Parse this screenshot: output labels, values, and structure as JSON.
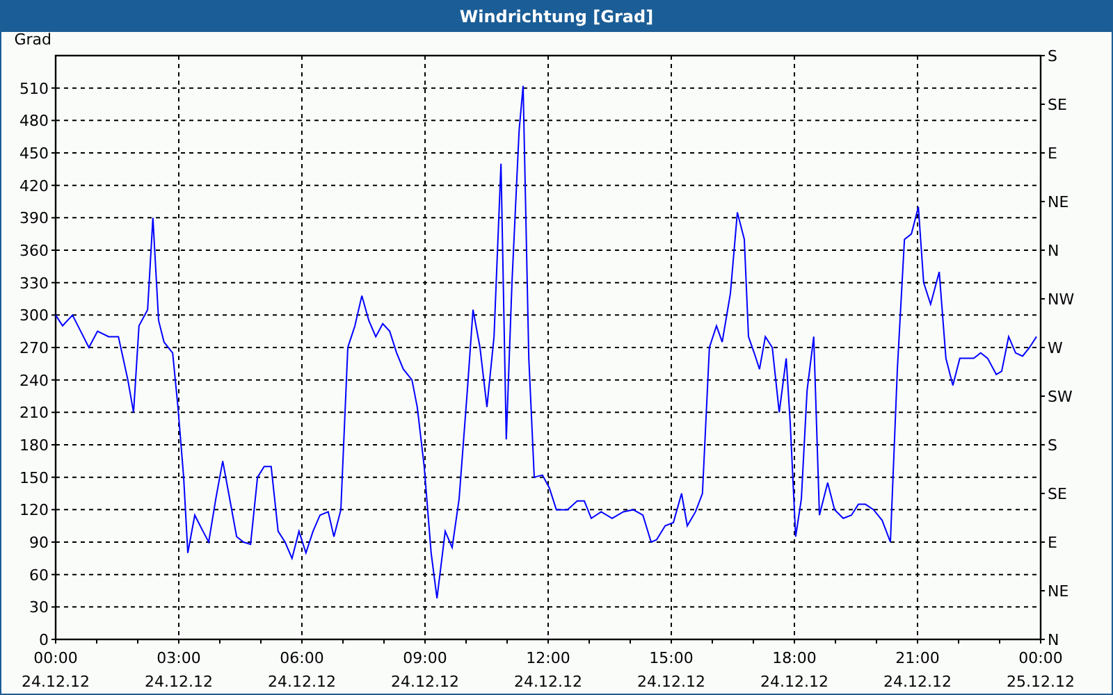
{
  "window": {
    "title": "Windrichtung [Grad]"
  },
  "chart": {
    "x_axis_dates": [
      "24.12.12",
      "24.12.12",
      "24.12.12",
      "24.12.12",
      "24.12.12",
      "24.12.12",
      "24.12.12",
      "24.12.12",
      "25.12.12"
    ],
    "right_axis_labels": [
      "S",
      "SE",
      "E",
      "NE",
      "N",
      "NW",
      "W",
      "SW",
      "S",
      "SE",
      "E",
      "NE",
      "N"
    ],
    "chart_data": {
      "type": "line",
      "ylabel": "Grad",
      "grid": true,
      "xlim": [
        0,
        24
      ],
      "ylim": [
        0,
        540
      ],
      "xticks": [
        {
          "value": 0,
          "label": "00:00"
        },
        {
          "value": 3,
          "label": "03:00"
        },
        {
          "value": 6,
          "label": "06:00"
        },
        {
          "value": 9,
          "label": "09:00"
        },
        {
          "value": 12,
          "label": "12:00"
        },
        {
          "value": 15,
          "label": "15:00"
        },
        {
          "value": 18,
          "label": "18:00"
        },
        {
          "value": 21,
          "label": "21:00"
        },
        {
          "value": 24,
          "label": "00:00"
        }
      ],
      "yticks": [
        0,
        30,
        60,
        90,
        120,
        150,
        180,
        210,
        240,
        270,
        300,
        330,
        360,
        390,
        420,
        450,
        480,
        510
      ],
      "x": [
        0,
        0.17,
        0.41,
        0.61,
        0.81,
        1.02,
        1.29,
        1.53,
        1.76,
        1.9,
        2.03,
        2.24,
        2.37,
        2.51,
        2.64,
        2.85,
        2.98,
        3.12,
        3.22,
        3.39,
        3.59,
        3.73,
        3.9,
        4.07,
        4.24,
        4.41,
        4.58,
        4.75,
        4.92,
        5.08,
        5.25,
        5.42,
        5.59,
        5.76,
        5.93,
        6.1,
        6.27,
        6.44,
        6.64,
        6.78,
        6.95,
        7.12,
        7.29,
        7.46,
        7.63,
        7.8,
        7.97,
        8.14,
        8.31,
        8.47,
        8.68,
        8.81,
        8.98,
        9.15,
        9.29,
        9.49,
        9.66,
        9.83,
        10.03,
        10.17,
        10.34,
        10.51,
        10.68,
        10.85,
        10.98,
        11.12,
        11.29,
        11.39,
        11.53,
        11.66,
        11.86,
        12.03,
        12.2,
        12.47,
        12.71,
        12.88,
        13.05,
        13.29,
        13.56,
        13.83,
        14.07,
        14.31,
        14.51,
        14.64,
        14.85,
        15.05,
        15.25,
        15.39,
        15.59,
        15.76,
        15.93,
        16.1,
        16.24,
        16.44,
        16.61,
        16.78,
        16.88,
        17.02,
        17.15,
        17.29,
        17.46,
        17.63,
        17.8,
        17.9,
        18.03,
        18.17,
        18.31,
        18.47,
        18.61,
        18.81,
        18.98,
        19.19,
        19.39,
        19.56,
        19.73,
        19.93,
        20.14,
        20.34,
        20.51,
        20.68,
        20.85,
        21.02,
        21.15,
        21.32,
        21.53,
        21.69,
        21.86,
        22.03,
        22.37,
        22.54,
        22.71,
        22.92,
        23.05,
        23.22,
        23.39,
        23.56,
        23.73,
        23.9
      ],
      "series": [
        {
          "color": "#0000ff",
          "values": [
            300,
            290,
            300,
            285,
            270,
            285,
            280,
            280,
            240,
            210,
            290,
            305,
            390,
            295,
            275,
            265,
            215,
            150,
            80,
            115,
            100,
            90,
            130,
            165,
            130,
            95,
            90,
            88,
            150,
            160,
            160,
            100,
            90,
            75,
            100,
            80,
            100,
            115,
            118,
            95,
            120,
            270,
            290,
            318,
            295,
            280,
            292,
            285,
            265,
            250,
            240,
            215,
            160,
            80,
            38,
            100,
            85,
            130,
            230,
            305,
            270,
            215,
            280,
            440,
            185,
            330,
            470,
            512,
            260,
            150,
            152,
            140,
            120,
            120,
            128,
            128,
            112,
            118,
            112,
            118,
            120,
            115,
            90,
            92,
            105,
            108,
            135,
            105,
            118,
            135,
            270,
            290,
            275,
            320,
            395,
            370,
            280,
            265,
            250,
            280,
            270,
            210,
            260,
            200,
            95,
            130,
            230,
            280,
            115,
            145,
            120,
            112,
            115,
            125,
            125,
            120,
            110,
            90,
            250,
            370,
            375,
            400,
            330,
            310,
            340,
            260,
            235,
            260,
            260,
            265,
            260,
            245,
            248,
            280,
            265,
            262,
            270,
            280
          ]
        }
      ]
    }
  }
}
